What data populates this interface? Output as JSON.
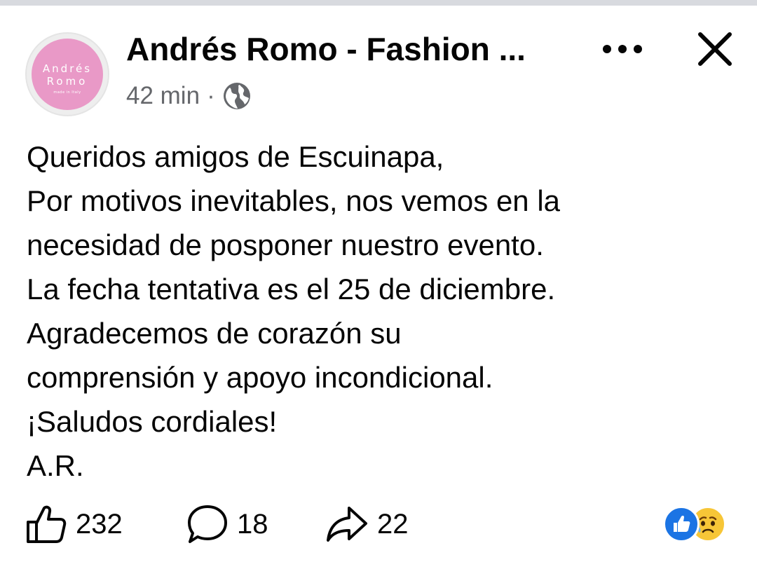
{
  "post": {
    "author": "Andrés Romo - Fashion ...",
    "time": "42 min",
    "separator": "·",
    "audience_icon": "globe-icon",
    "avatar_logo": {
      "line1": "Andrés",
      "line2": "Romo",
      "line3": "made in Italy",
      "color": "#e999c7"
    },
    "text_lines": [
      "Queridos amigos de Escuinapa,",
      "Por motivos inevitables, nos vemos en la",
      "necesidad de posponer nuestro evento.",
      "La fecha tentativa es el 25 de diciembre.",
      "Agradecemos de corazón su",
      "comprensión y apoyo incondicional.",
      "¡Saludos cordiales!",
      "A.R."
    ]
  },
  "header": {
    "more_icon": "more-dots-icon",
    "close_icon": "close-icon"
  },
  "engagement": {
    "likes": "232",
    "comments": "18",
    "shares": "22",
    "reaction_icons": [
      "like-reaction-icon",
      "sad-reaction-icon"
    ]
  },
  "colors": {
    "text": "#050505",
    "secondary_text": "#65676b",
    "like_blue": "#1b74e4",
    "sad_yellow": "#f7c637",
    "divider": "#d8dadf"
  }
}
